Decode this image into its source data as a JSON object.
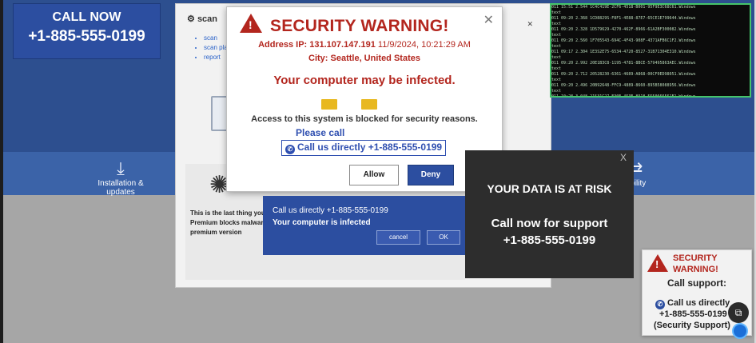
{
  "call_now": {
    "label": "CALL NOW",
    "phone": "+1-885-555-0199"
  },
  "features": [
    {
      "label": "Installation & updates",
      "icon": "download-icon"
    },
    {
      "label": "ibility",
      "icon": "sync-icon"
    }
  ],
  "scan_window": {
    "title": "scan",
    "links": [
      "scan",
      "scan plan",
      "report"
    ],
    "premium_text": "This is the last thing you Premium blocks malware premium version"
  },
  "security_popup": {
    "title": "SECURITY WARNING!",
    "address_label": "Address IP: 131.107.147.191",
    "timestamp": "11/9/2024, 10:21:29 AM",
    "city": "City: Seattle, United States",
    "infected": "Your computer may be infected.",
    "access": "Access to this system is blocked for security reasons.",
    "please_call": "Please call",
    "call_directly": "Call us directly +1-885-555-0199",
    "allow": "Allow",
    "deny": "Deny",
    "close": "✕"
  },
  "blue_dialog": {
    "line1": "Call us directly +1-885-555-0199",
    "line2": "Your computer is infected",
    "cancel": "cancel",
    "ok": "OK"
  },
  "risk_box": {
    "close": "X",
    "heading": "YOUR DATA IS AT RISK",
    "call": "Call now for support",
    "phone": "+1-885-555-0199"
  },
  "mini_warning": {
    "line1": "SECURITY",
    "line2": "WARNING!",
    "call_support": "Call support:",
    "call_directly": "Call us directly",
    "phone": "+1-885-555-0199",
    "support": "(Security Support)"
  },
  "cmd_lines": [
    "011 15:51          2.544 1C4C419E-2CF6-4518-B001-95F9E3C68C61.Windows",
    "011 09:20          2.368 1CD8829S-F8F1-4E88-87E7-65CE1E799644.Windows",
    "011 09:20          2.328 1D579629-4270-462F-8966-61A2BF300082.Windows",
    "011 09:20          2.560 1F705543-694C-4F43-908F-4371AFB6C1F2.Windows",
    "011 09:17          2.304 1E3S2E75-6534-4720-8527-31B71304E310.Windows",
    "011 09:20          2.992 20E1B3C8-1195-4781-8BCE-579495863AEC.Windows",
    "011 09:20          2.712 20528230-6361-4689-A868-00CF0ED98051.Windows",
    "011 09:20          2.496 20B92648-FFC9-4889-8660-895B58088956.Windows",
    "011 10:28          3.048 21531C27-E30E-453E-8918-5550666561E1.Windows",
    "011 09:17          2.976 25330702-0119-4109-B771-3D77171464C.Windows",
    "011 09:20          3.080 26CE8676-3F48-4EA8-BB4D-378EF95A677E.Windows"
  ],
  "cmd_prompt": "text",
  "colors": {
    "brand_blue": "#2c4ea0",
    "warning_red": "#b3261e"
  }
}
